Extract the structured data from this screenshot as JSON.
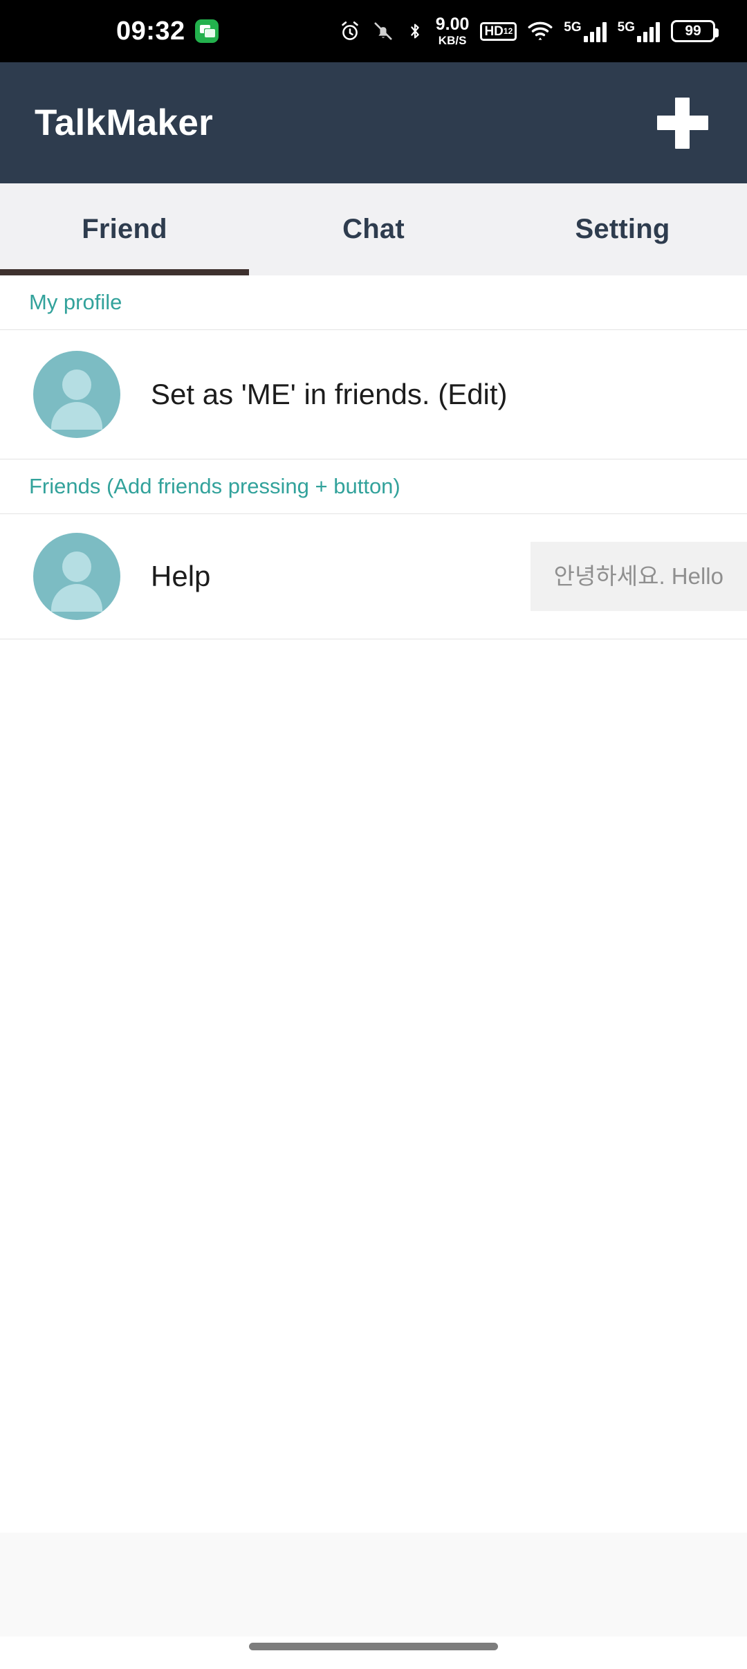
{
  "status_bar": {
    "time": "09:32",
    "app_icon_name": "messages-icon",
    "icons": {
      "alarm": "alarm-icon",
      "mute": "bell-muted-icon",
      "bluetooth": "bluetooth-icon",
      "hd_badge": "HD",
      "hd_sup": "1",
      "hd_sub": "2",
      "wifi": "wifi-icon"
    },
    "net_speed_value": "9.00",
    "net_speed_unit": "KB/S",
    "sim1_network": "5G",
    "sim2_network": "5G",
    "battery_percent": "99"
  },
  "app_bar": {
    "title": "TalkMaker",
    "add_button_label": "+"
  },
  "tabs": [
    {
      "label": "Friend",
      "active": true
    },
    {
      "label": "Chat",
      "active": false
    },
    {
      "label": "Setting",
      "active": false
    }
  ],
  "sections": {
    "my_profile": {
      "header": "My profile",
      "row": {
        "avatar": "person-avatar-icon",
        "name": "Set as 'ME' in friends. (Edit)"
      }
    },
    "friends": {
      "header": "Friends (Add friends pressing + button)",
      "rows": [
        {
          "avatar": "person-avatar-icon",
          "name": "Help",
          "status_message": "안녕하세요. Hello"
        }
      ]
    }
  },
  "colors": {
    "app_bar_bg": "#2e3c4e",
    "tab_bar_bg": "#f1f1f3",
    "tab_indicator": "#3e312e",
    "section_header_text": "#32a29b",
    "avatar_bg": "#7cbcc3",
    "avatar_glyph": "#b5dee3",
    "bubble_bg": "#f1f1f1",
    "bubble_text": "#8f8f8f",
    "status_bar_bg": "#000000",
    "ad_band_bg": "#f9f9f9"
  }
}
